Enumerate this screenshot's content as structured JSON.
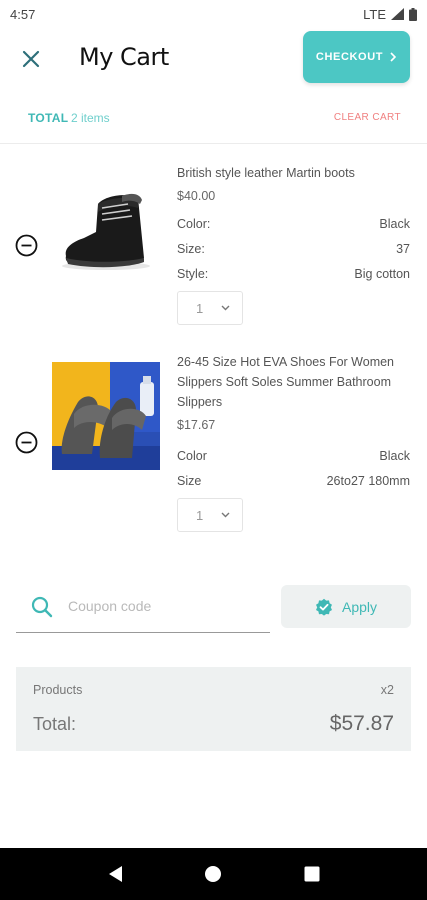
{
  "status_bar": {
    "time": "4:57",
    "network": "LTE"
  },
  "header": {
    "title": "My Cart",
    "checkout_label": "CHECKOUT"
  },
  "summary_bar": {
    "total_label": "TOTAL",
    "items_count": "2 items",
    "clear_cart_label": "CLEAR CART"
  },
  "items": [
    {
      "name": "British style leather Martin boots",
      "price": "$40.00",
      "attributes": [
        {
          "label": "Color:",
          "value": "Black"
        },
        {
          "label": "Size:",
          "value": "37"
        },
        {
          "label": "Style:",
          "value": "Big cotton"
        }
      ],
      "quantity": "1"
    },
    {
      "name": "26-45 Size Hot EVA Shoes For Women Slippers Soft Soles Summer Bathroom Slippers",
      "price": "$17.67",
      "attributes": [
        {
          "label": "Color",
          "value": "Black"
        },
        {
          "label": "Size",
          "value": "26to27 180mm"
        }
      ],
      "quantity": "1"
    }
  ],
  "coupon": {
    "placeholder": "Coupon code",
    "value": "",
    "apply_label": "Apply"
  },
  "totals": {
    "products_label": "Products",
    "products_count": "x2",
    "total_label": "Total:",
    "total_value": "$57.87"
  },
  "colors": {
    "accent": "#4cc7c4",
    "accent_text": "#3fb8b5",
    "clear_cart": "#f08080",
    "summary_bg": "#eef1f1"
  }
}
